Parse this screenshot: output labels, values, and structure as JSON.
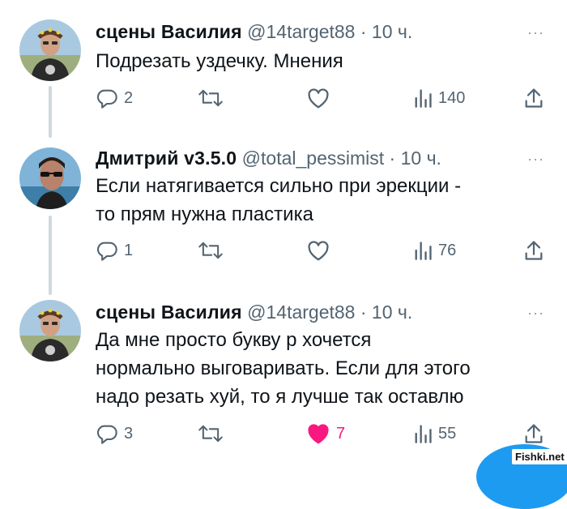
{
  "tweets": [
    {
      "author": "сцены Василия",
      "handle": "@14target88",
      "dot": "·",
      "time": "10 ч.",
      "more": "···",
      "lines": [
        "Подрезать уздечку. Мнения"
      ],
      "replies": "2",
      "retweets": "",
      "likes": "",
      "views": "140"
    },
    {
      "author": "Дмитрий v3.5.0",
      "handle": "@total_pessimist",
      "dot": "·",
      "time": "10 ч.",
      "more": "···",
      "lines": [
        "Если натягивается сильно при эрекции -",
        "то прям нужна пластика"
      ],
      "replies": "1",
      "retweets": "",
      "likes": "",
      "views": "76"
    },
    {
      "author": "сцены Василия",
      "handle": "@14target88",
      "dot": "·",
      "time": "10 ч.",
      "more": "···",
      "lines": [
        "Да мне просто букву р хочется",
        "нормально выговаривать. Если для этого",
        "надо резать хуй, то я лучше так оставлю"
      ],
      "replies": "3",
      "retweets": "",
      "likes": "7",
      "views": "55",
      "liked": true
    }
  ],
  "colors": {
    "text": "#0f1419",
    "secondary": "#536471",
    "like": "#f91880",
    "thread_line": "#cfd9de",
    "accent": "#1d9bf0"
  },
  "icons": [
    "reply-icon",
    "retweet-icon",
    "like-icon",
    "views-icon",
    "share-icon",
    "more-icon"
  ],
  "watermark": "Fishki.net"
}
